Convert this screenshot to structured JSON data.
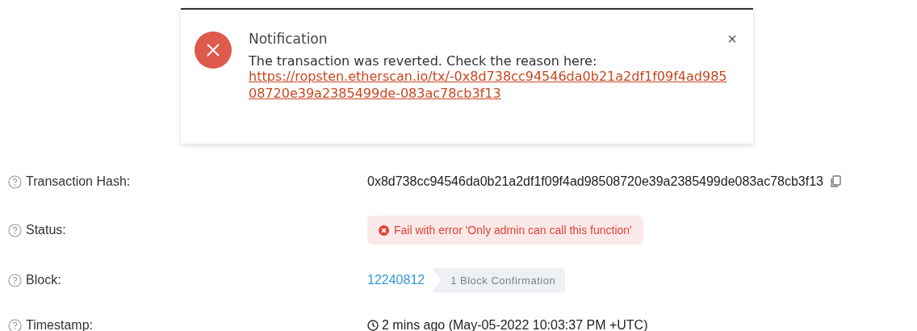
{
  "notification": {
    "title": "Notification",
    "message": "The transaction was reverted. Check the reason here:",
    "link": "https://ropsten.etherscan.io/tx/-0x8d738cc94546da0b21a2df1f09f4ad98508720e39a2385499de-083ac78cb3f13",
    "close": "×"
  },
  "rows": [
    {
      "kind": "hash",
      "label": "Transaction Hash:",
      "value": "0x8d738cc94546da0b21a2df1f09f4ad98508720e39a2385499de083ac78cb3f13"
    },
    {
      "kind": "status",
      "label": "Status:",
      "value": "Fail with error 'Only admin can call this function'"
    },
    {
      "kind": "block",
      "label": "Block:",
      "value": "12240812",
      "confirmations": "1 Block Confirmation"
    },
    {
      "kind": "timestamp",
      "label": "Timestamp:",
      "value": "2 mins ago (May-05-2022 10:03:37 PM +UTC)"
    }
  ]
}
